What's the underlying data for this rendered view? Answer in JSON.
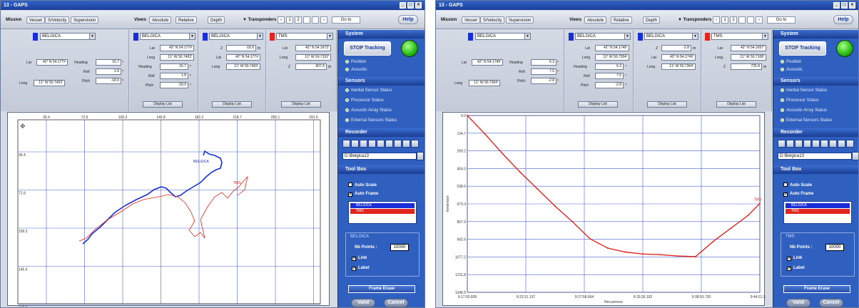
{
  "colors": {
    "blue_track": "#1a2ed8",
    "red_track": "#e0261e",
    "grid": "#4b62c9",
    "title_bar": "#1c3f9a",
    "right_panel": "#2f5fbf",
    "led": "#2ec11a"
  },
  "win1": {
    "title": "13 - GAPS",
    "menu": {
      "mission": "Mission",
      "vessel": "Vessel",
      "svelocity": "S/Velocity",
      "supervision": "Supervision",
      "views": "Views",
      "absolute": "Absolute",
      "relative": "Relative",
      "depth": "Depth",
      "transponders": "Transponders",
      "p1": "1",
      "p2": "2",
      "goto": "Go to",
      "help": "Help"
    },
    "vessel": {
      "combo": "BELGICA",
      "lat_label": "Lat",
      "lat": "42° N 54.177#",
      "long_label": "Long",
      "long": "11° W 50.7403'",
      "heading_label": "Heading",
      "heading": "15.7",
      "roll_label": "Roll",
      "roll": "1.8",
      "pitch_label": "Pitch",
      "pitch": "-18.9"
    },
    "abs": {
      "combo": "BELGICA",
      "lat_label": "Lat",
      "lat": "42° N 54.177#",
      "long_label": "Long",
      "long": "11° W 50.7403'",
      "heading_label": "Heading",
      "heading": "15.7",
      "roll_label": "Roll",
      "roll": "1.8",
      "pitch_label": "Pitch",
      "pitch": "-18.9",
      "display": "Display List"
    },
    "rel": {
      "combo": "BELGICA",
      "z_label": "Z",
      "z": "-18.9",
      "lat_label": "Lat",
      "lat": "42° N 54.177#",
      "long_label": "Long",
      "long": "11° W 50.7403'",
      "display": "Display List"
    },
    "tms": {
      "combo": "TMS",
      "lat_label": "Lat",
      "lat": "42° N 54.1673'",
      "long_label": "Long",
      "long": "11° W 50.7152'",
      "z_label": "Z",
      "z": "607.6",
      "display": "Display List"
    },
    "system": {
      "header": "System",
      "stop": "STOP Tracking",
      "position": "Position",
      "acoustic": "Acoustic"
    },
    "sensors": {
      "header": "Sensors",
      "items": [
        "Inertial Sensor Status",
        "Processor Status",
        "Acoustic Array Status",
        "External Sensors Status"
      ]
    },
    "recorder": {
      "header": "Recorder",
      "path": "D:\\Belgica13"
    },
    "toolbox": {
      "header": "Tool Box",
      "auto_scale": "Auto Scale",
      "auto_frame": "Auto Frame",
      "list": [
        "BELGICA",
        "TMS"
      ],
      "group": "BELGICA",
      "nb_points_label": "Nb Points :",
      "nb_points": "10000",
      "link": "Link",
      "label": "Label",
      "frame": "Frame Erase"
    },
    "valid": "Valid",
    "cancel": "Cancel",
    "chart_data": {
      "type": "scatter",
      "x_ticks": [
        "36.4",
        "72.9",
        "109.3",
        "145.8",
        "182.2",
        "218.7",
        "255.1",
        "291.6"
      ],
      "y_ticks": [
        "36.4",
        "72.8",
        "109.2",
        "145.6",
        "182.2"
      ],
      "series": [
        {
          "name": "BELGICA",
          "color": "#1a2ed8"
        },
        {
          "name": "TMS",
          "color": "#e0261e"
        }
      ],
      "labels": [
        "BELGICA",
        "TMS"
      ],
      "grid": true
    }
  },
  "win2": {
    "title": "13 - GAPS",
    "menu": {
      "mission": "Mission",
      "vessel": "Vessel",
      "svelocity": "S/Velocity",
      "supervision": "Supervision",
      "views": "Views",
      "absolute": "Absolute",
      "relative": "Relative",
      "depth": "Depth",
      "transponders": "Transponders",
      "p1": "1",
      "p2": "2",
      "goto": "Go to",
      "help": "Help"
    },
    "vessel": {
      "combo": "BELGICA",
      "lat_label": "Lat",
      "lat": "42° N 54.1749'",
      "long_label": "Long",
      "long": "11° W 50.7304'",
      "heading_label": "Heading",
      "heading": "6.3",
      "roll_label": "Roll",
      "roll": "7.5",
      "pitch_label": "Pitch",
      "pitch": "-2.8"
    },
    "abs": {
      "combo": "BELGICA",
      "lat_label": "Lat",
      "lat": "42° N 54.1749'",
      "long_label": "Long",
      "long": "11° W 50.7304'",
      "heading_label": "Heading",
      "heading": "6.3",
      "roll_label": "Roll",
      "roll": "7.5",
      "pitch_label": "Pitch",
      "pitch": "-2.8",
      "display": "Display List"
    },
    "rel": {
      "combo": "BELGICA",
      "z_label": "Z",
      "z": "-2.8",
      "lat_label": "Lat",
      "lat": "42° N 54.1749'",
      "long_label": "Long",
      "long": "11° W 50.7304'",
      "display": "Display List"
    },
    "tms": {
      "combo": "TMS",
      "lat_label": "Lat",
      "lat": "42° N 54.1657'",
      "long_label": "Long",
      "long": "11° W 50.7108'",
      "z_label": "Z",
      "z": "725.8",
      "display": "Display List"
    },
    "system": {
      "header": "System",
      "stop": "STOP Tracking",
      "position": "Position",
      "acoustic": "Acoustic"
    },
    "sensors": {
      "header": "Sensors",
      "items": [
        "Inertial Sensor Status",
        "Processor Status",
        "Acoustic Array Status",
        "External Sensors Status"
      ]
    },
    "recorder": {
      "header": "Recorder",
      "path": "D:\\Belgica13"
    },
    "toolbox": {
      "header": "Tool Box",
      "auto_scale": "Auto Scale",
      "auto_frame": "Auto Frame",
      "list": [
        "BELGICA",
        "TMS"
      ],
      "group": "TMS",
      "nb_points_label": "Nb Points :",
      "nb_points": "10000",
      "link": "Link",
      "label": "Label",
      "frame": "Frame Erase"
    },
    "valid": "Valid",
    "cancel": "Cancel",
    "chart_data": {
      "type": "line",
      "xlabel": "Recurrence",
      "ylabel": "Immersion",
      "x_ticks": [
        "9:17:03.609",
        "9:22:31.137",
        "9:27:58.664",
        "9:33:26.192",
        "9:38:53.720",
        "9:44:21.247"
      ],
      "y_ticks": [
        "0.0",
        "134.7",
        "269.2",
        "404.0",
        "538.6",
        "673.3",
        "807.9",
        "942.6",
        "1077.2",
        "1211.8",
        "1346.5"
      ],
      "x": [
        0,
        0.3,
        0.6,
        0.9,
        1.2,
        1.5,
        1.8,
        2.1,
        2.4,
        2.7,
        3.0,
        3.3,
        3.6,
        3.9,
        4.2,
        4.5,
        4.8,
        5.0
      ],
      "y": [
        0,
        140,
        290,
        430,
        560,
        690,
        810,
        940,
        1010,
        1040,
        1055,
        1060,
        1070,
        1075,
        960,
        860,
        760,
        670
      ],
      "series": [
        {
          "name": "TMS",
          "color": "#e0261e"
        }
      ],
      "labels": [
        "TMS"
      ],
      "grid": true
    }
  }
}
